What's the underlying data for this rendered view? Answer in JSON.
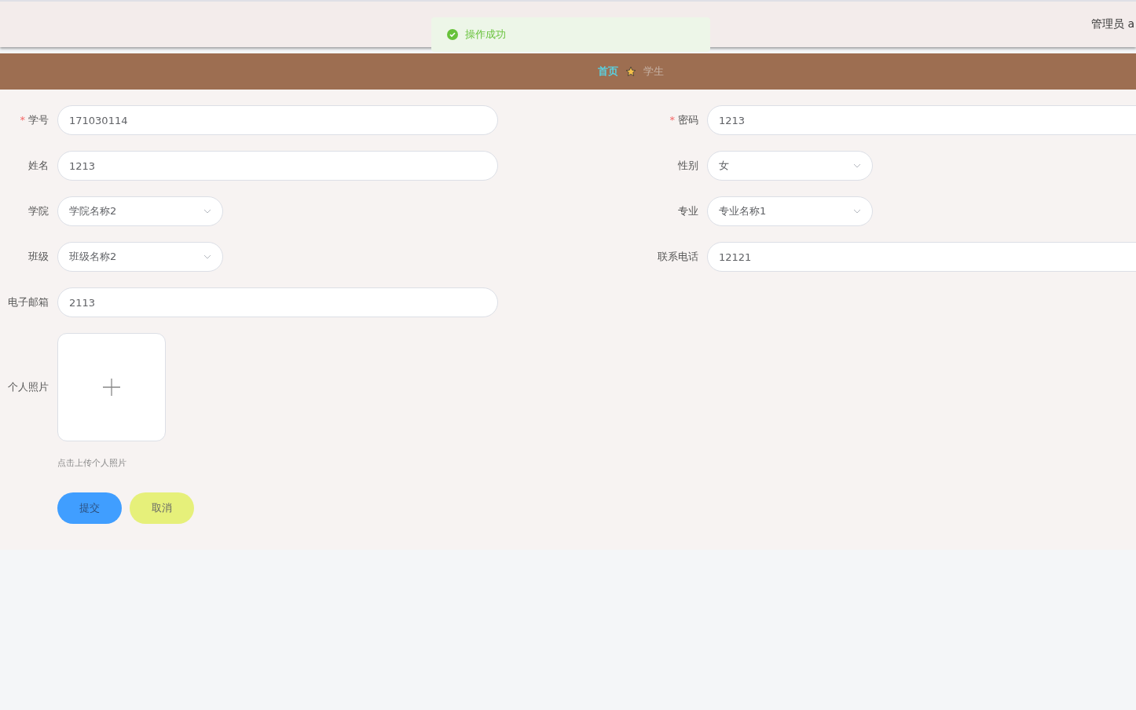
{
  "header": {
    "user": "管理员 a"
  },
  "toast": {
    "message": "操作成功"
  },
  "breadcrumb": [
    {
      "label": "首页",
      "selected": true
    },
    {
      "label": "学生",
      "selected": false
    }
  ],
  "form": {
    "rows": [
      {
        "left": {
          "mark": "*",
          "label": "学号",
          "kind": "text",
          "value": "171030114"
        },
        "right": {
          "mark": "*",
          "label": "密码",
          "kind": "text",
          "value": "1213"
        }
      },
      {
        "left": {
          "label": "姓名",
          "kind": "text",
          "value": "1213"
        },
        "right": {
          "label": "性别",
          "kind": "select",
          "value": "女"
        }
      },
      {
        "left": {
          "label": "学院",
          "kind": "select",
          "value": "学院名称2"
        },
        "right": {
          "label": "专业",
          "kind": "select",
          "value": "专业名称1"
        }
      },
      {
        "left": {
          "label": "班级",
          "kind": "select",
          "value": "班级名称2"
        },
        "right": {
          "label": "联系电话",
          "kind": "text",
          "value": "12121"
        }
      },
      {
        "left": {
          "label": "电子邮箱",
          "kind": "text",
          "value": "2113"
        },
        "right": null
      }
    ],
    "upload": {
      "label": "个人照片",
      "hint": "点击上传个人照片"
    },
    "buttons": [
      {
        "label": "提交",
        "kind": "primary"
      },
      {
        "label": "取消",
        "kind": "secondary"
      }
    ]
  }
}
